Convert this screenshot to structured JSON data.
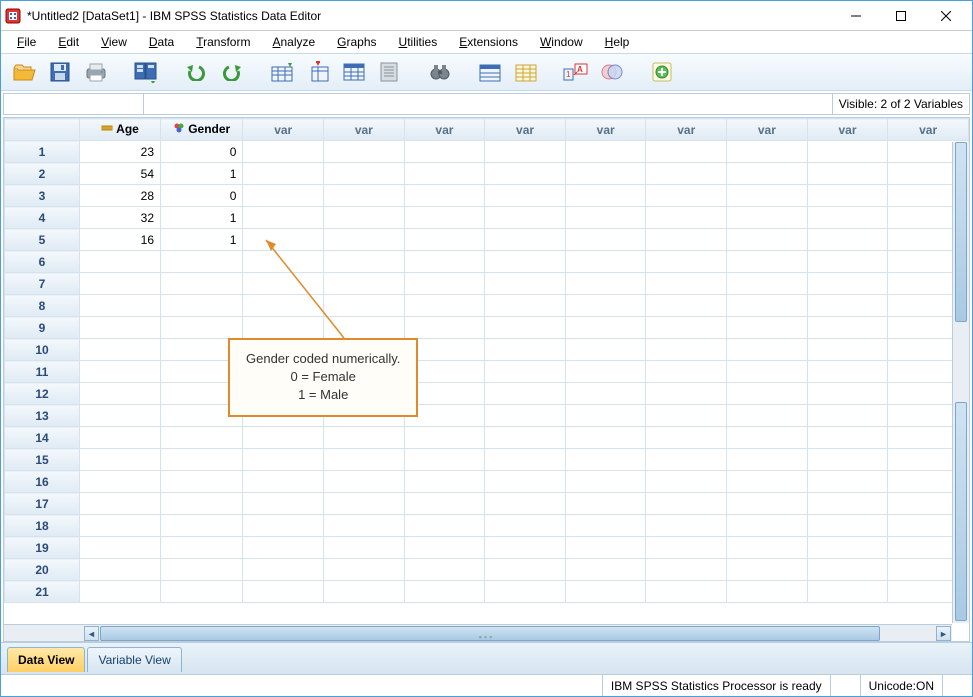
{
  "title": "*Untitled2 [DataSet1] - IBM SPSS Statistics Data Editor",
  "menu": [
    "File",
    "Edit",
    "View",
    "Data",
    "Transform",
    "Analyze",
    "Graphs",
    "Utilities",
    "Extensions",
    "Window",
    "Help"
  ],
  "visible_label": "Visible: 2 of 2 Variables",
  "columns": [
    {
      "name": "Age",
      "icon": "ruler"
    },
    {
      "name": "Gender",
      "icon": "nominal"
    }
  ],
  "var_placeholder": "var",
  "empty_col_count": 9,
  "rows": [
    {
      "n": 1,
      "Age": 23,
      "Gender": 0
    },
    {
      "n": 2,
      "Age": 54,
      "Gender": 1
    },
    {
      "n": 3,
      "Age": 28,
      "Gender": 0
    },
    {
      "n": 4,
      "Age": 32,
      "Gender": 1
    },
    {
      "n": 5,
      "Age": 16,
      "Gender": 1
    }
  ],
  "empty_rows": [
    6,
    7,
    8,
    9,
    10,
    11,
    12,
    13,
    14,
    15,
    16,
    17,
    18,
    19,
    20,
    21
  ],
  "callout": {
    "line1": "Gender coded numerically.",
    "line2": "0 = Female",
    "line3": "1 = Male"
  },
  "tabs": {
    "data": "Data View",
    "variable": "Variable View"
  },
  "status": {
    "processor": "IBM SPSS Statistics Processor is ready",
    "unicode": "Unicode:ON"
  }
}
